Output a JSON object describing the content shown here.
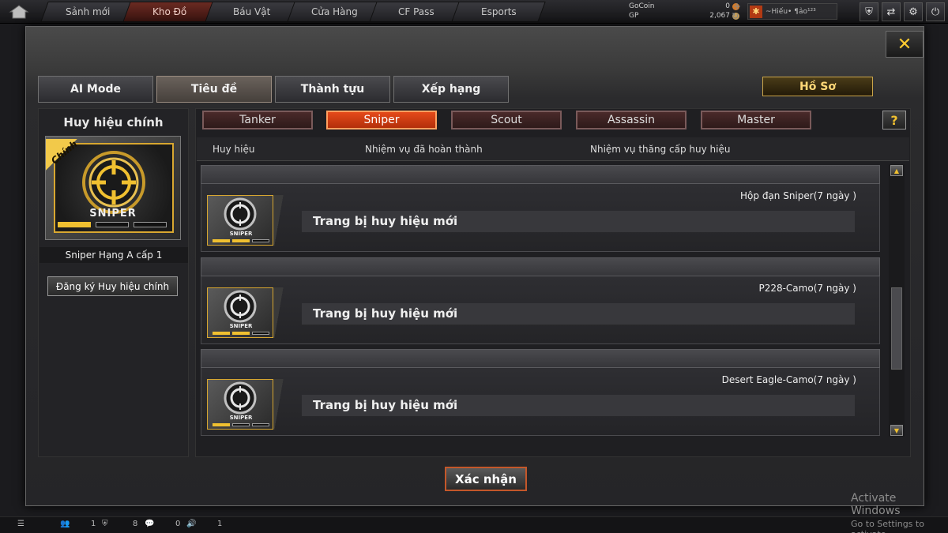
{
  "topbar": {
    "tabs": [
      {
        "label": "Sảnh mới"
      },
      {
        "label": "Kho Đồ"
      },
      {
        "label": "Báu Vật"
      },
      {
        "label": "Cửa Hàng"
      },
      {
        "label": "CF Pass"
      },
      {
        "label": "Esports"
      }
    ],
    "active_tab": "Kho Đồ",
    "gocoin_label": "GoCoin",
    "gocoin_value": "0",
    "gp_label": "GP",
    "gp_value": "2,067",
    "player_name": "~Hiếu• ¶ảo¹²³",
    "icons": [
      "home-icon",
      "shield-icon",
      "exit-icon",
      "gear-icon",
      "power-icon"
    ]
  },
  "modal": {
    "tabs": [
      {
        "label": "AI Mode"
      },
      {
        "label": "Tiêu đề"
      },
      {
        "label": "Thành tựu"
      },
      {
        "label": "Xếp hạng"
      }
    ],
    "active_tab": "Tiêu đề",
    "profile_button": "Hồ Sơ",
    "close_label": "✕",
    "left": {
      "title": "Huy hiệu chính",
      "badge_ribbon": "Chính",
      "badge_name": "SNIPER",
      "badge_progress": 1,
      "rank_text": "Sniper Hạng A cấp 1",
      "register_button": "Đăng ký Huy hiệu chính"
    },
    "subtabs": [
      {
        "label": "Tanker"
      },
      {
        "label": "Sniper"
      },
      {
        "label": "Scout"
      },
      {
        "label": "Assassin"
      },
      {
        "label": "Master"
      }
    ],
    "active_subtab": "Sniper",
    "help_label": "?",
    "columns": [
      "Huy hiệu",
      "Nhiệm vụ đã hoàn thành",
      "Nhiệm vụ thăng cấp huy hiệu"
    ],
    "items": [
      {
        "badge_name": "SNIPER",
        "reward": "Hộp đạn Sniper(7 ngày )",
        "task": "Trang bị huy hiệu mới",
        "progress": 2
      },
      {
        "badge_name": "SNIPER",
        "reward": "P228-Camo(7 ngày )",
        "task": "Trang bị huy hiệu mới",
        "progress": 2
      },
      {
        "badge_name": "SNIPER",
        "reward": "Desert Eagle-Camo(7 ngày )",
        "task": "Trang bị huy hiệu mới",
        "progress": 1
      }
    ],
    "confirm_button": "Xác nhận"
  },
  "bottombar": {
    "count1": "1",
    "count2": "8",
    "count3": "0",
    "count4": "1"
  },
  "watermark": {
    "line1": "Activate Windows",
    "line2": "Go to Settings to activate"
  },
  "colors": {
    "accent_orange": "#e54a1a",
    "gold": "#f0c030",
    "panel_bg": "#252528"
  }
}
